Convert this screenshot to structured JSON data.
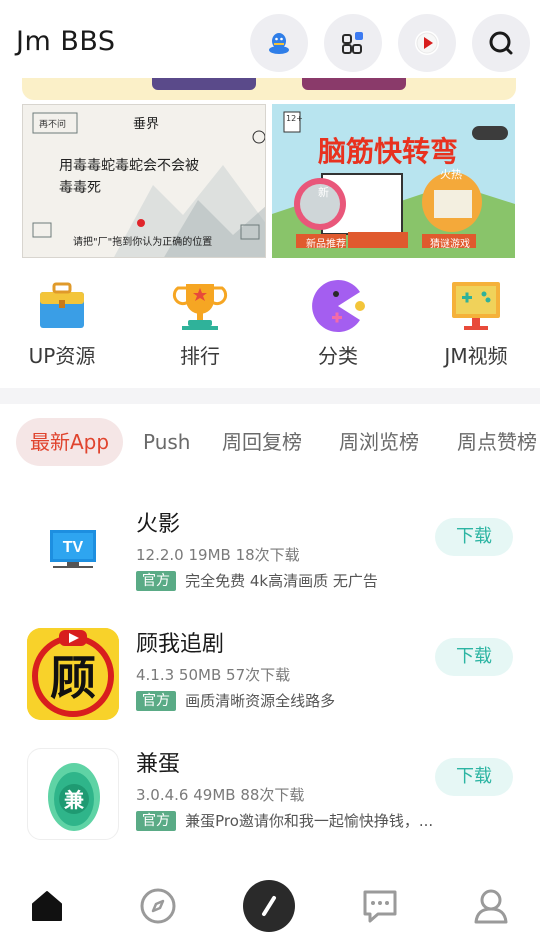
{
  "header": {
    "title": "Jm BBS",
    "buttons": [
      "qq-icon",
      "apps-grid-icon",
      "video-play-icon",
      "search-icon"
    ]
  },
  "banner": {
    "card1_text": [
      "再不问",
      "垂界",
      "用毒毒蛇毒蛇会不会被",
      "毒毒死",
      "请把\"厂\"拖到你认为正确的位置"
    ],
    "card2_title": "脑筋快转弯",
    "card2_labels": [
      "新",
      "新品推荐",
      "火热",
      "猜谜游戏",
      "12+"
    ]
  },
  "quick_grid": [
    {
      "label": "UP资源",
      "icon": "toolbox-icon"
    },
    {
      "label": "排行",
      "icon": "trophy-icon"
    },
    {
      "label": "分类",
      "icon": "pacman-icon"
    },
    {
      "label": "JM视频",
      "icon": "game-screen-icon"
    }
  ],
  "tabs": [
    "最新App",
    "Push",
    "周回复榜",
    "周浏览榜",
    "周点赞榜"
  ],
  "active_tab": "最新App",
  "apps": [
    {
      "name": "火影",
      "meta": "12.2.0 19MB 18次下载",
      "badge": "官方",
      "desc": "完全免费 4k高清画质 无广告",
      "button": "下载",
      "icon": "tv-icon"
    },
    {
      "name": "顾我追剧",
      "meta": "4.1.3 50MB 57次下载",
      "badge": "官方",
      "desc": "画质清晰资源全线路多",
      "button": "下载",
      "icon": "gu-logo-icon"
    },
    {
      "name": "兼蛋",
      "meta": "3.0.4.6 49MB 88次下载",
      "badge": "官方",
      "desc": "兼蛋Pro邀请你和我一起愉快挣钱，...",
      "button": "下载",
      "icon": "jiandan-egg-icon"
    }
  ],
  "bottom_nav": [
    "home-icon",
    "compass-icon",
    "pen-icon",
    "chat-icon",
    "profile-icon"
  ],
  "colors": {
    "accent": "#e0442e",
    "download_text": "#2db5a3",
    "download_bg": "#e6f7f5",
    "badge": "#5aab86"
  }
}
